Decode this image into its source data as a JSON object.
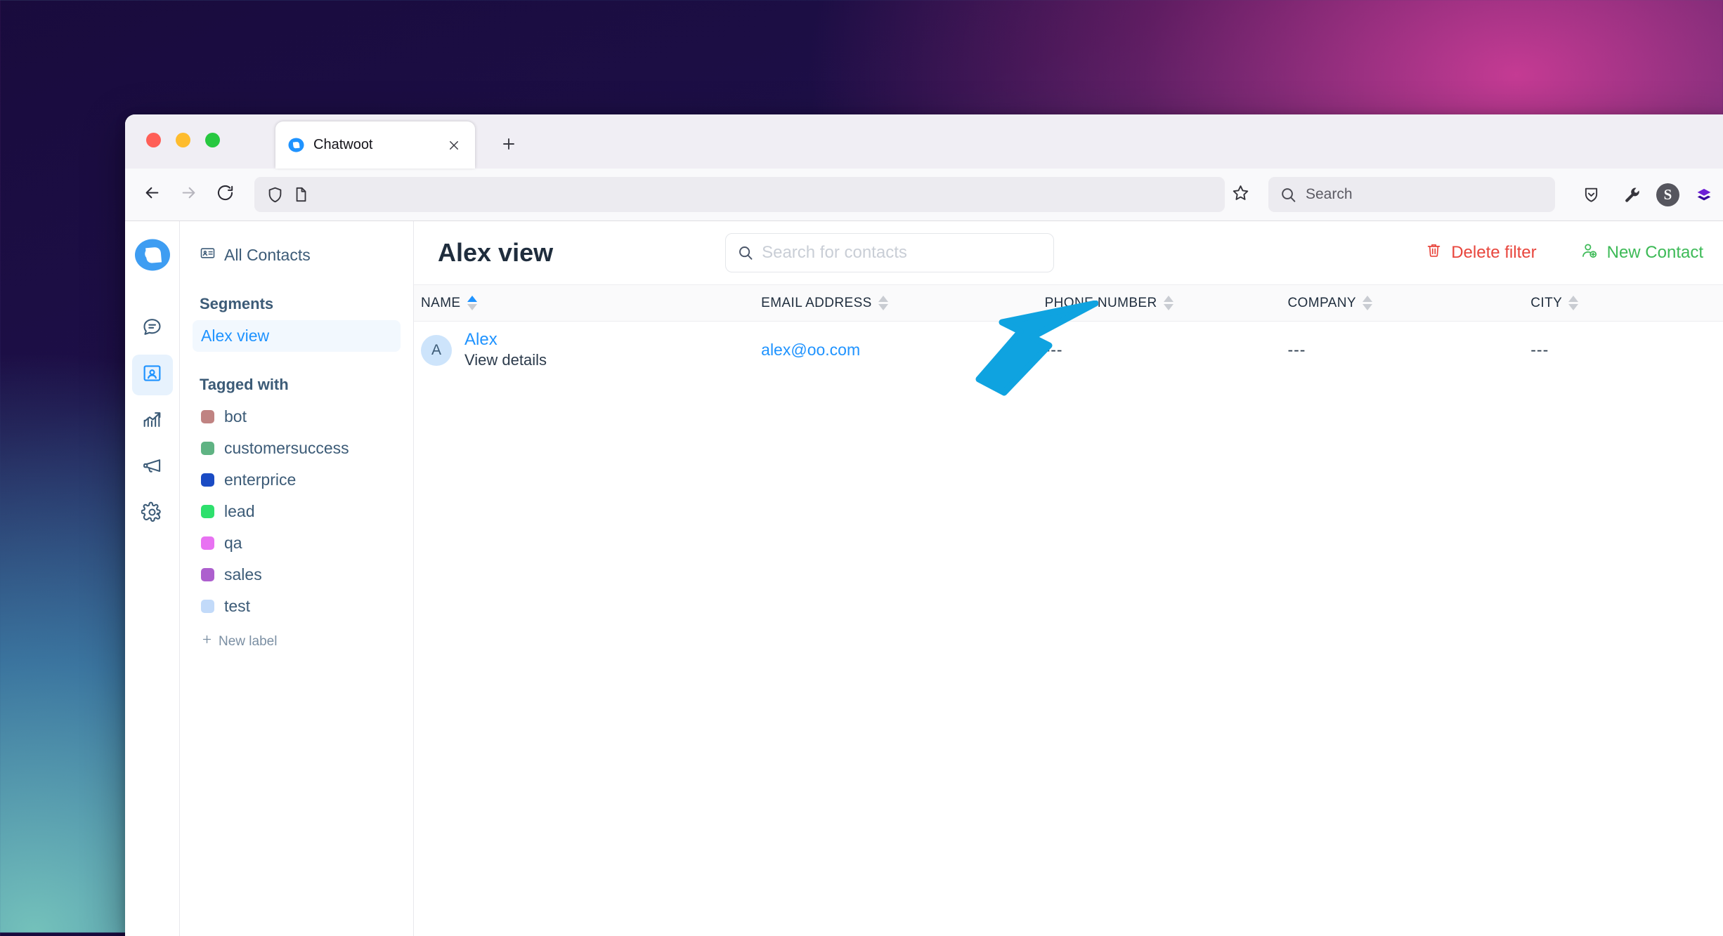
{
  "browser": {
    "tab": {
      "title": "Chatwoot",
      "favicon_icon": "chatwoot-logo-icon",
      "close_icon": "close-icon"
    },
    "new_tab_icon": "plus-icon",
    "nav": {
      "back_icon": "back-arrow-icon",
      "forward_icon": "forward-arrow-icon",
      "reload_icon": "reload-icon"
    },
    "urlbar": {
      "value": "",
      "shield_icon": "shield-icon",
      "page_icon": "page-document-icon",
      "bookmark_icon": "star-icon"
    },
    "search": {
      "placeholder": "Search",
      "icon": "search-icon"
    },
    "toolbar_right": {
      "pocket_icon": "pocket-shield-icon",
      "wrench_icon": "wrench-icon",
      "ext_s_label": "S",
      "layers_icon": "layers-diamond-icon"
    },
    "traffic_lights": [
      "close",
      "minimize",
      "maximize"
    ]
  },
  "rail": {
    "logo_icon": "chatwoot-logo-icon",
    "items": [
      {
        "name": "conversations",
        "icon": "chat-bubble-icon",
        "active": false
      },
      {
        "name": "contacts",
        "icon": "contact-book-icon",
        "active": true
      },
      {
        "name": "reports",
        "icon": "chart-trend-icon",
        "active": false
      },
      {
        "name": "campaigns",
        "icon": "megaphone-icon",
        "active": false
      },
      {
        "name": "settings",
        "icon": "gear-icon",
        "active": false
      }
    ]
  },
  "sidebar": {
    "all_contacts": {
      "label": "All Contacts",
      "icon": "contact-card-icon"
    },
    "segments_heading": "Segments",
    "segments": [
      {
        "label": "Alex view",
        "active": true
      }
    ],
    "tags_heading": "Tagged with",
    "tags": [
      {
        "label": "bot",
        "color": "#c08382"
      },
      {
        "label": "customersuccess",
        "color": "#5fb383"
      },
      {
        "label": "enterprice",
        "color": "#1a4bc4"
      },
      {
        "label": "lead",
        "color": "#2ee06d"
      },
      {
        "label": "qa",
        "color": "#e872f2"
      },
      {
        "label": "sales",
        "color": "#ad5fce"
      },
      {
        "label": "test",
        "color": "#c2daf9"
      }
    ],
    "new_label": {
      "label": "New label",
      "icon": "plus-icon"
    }
  },
  "main": {
    "page_title": "Alex view",
    "contact_search": {
      "placeholder": "Search for contacts",
      "value": "",
      "icon": "search-icon"
    },
    "delete_filter": {
      "label": "Delete filter",
      "icon": "trash-icon",
      "color": "#e8453c"
    },
    "new_contact": {
      "label": "New Contact",
      "icon": "user-plus-icon",
      "color": "#3dba57"
    },
    "table": {
      "columns": [
        {
          "label": "NAME",
          "sort": "asc"
        },
        {
          "label": "EMAIL ADDRESS",
          "sort": "none"
        },
        {
          "label": "PHONE NUMBER",
          "sort": "none"
        },
        {
          "label": "COMPANY",
          "sort": "none"
        },
        {
          "label": "CITY",
          "sort": "none"
        }
      ],
      "rows": [
        {
          "avatar_initial": "A",
          "name": "Alex",
          "view_details": "View details",
          "email": "alex@oo.com",
          "phone": "---",
          "company": "---",
          "city": "---"
        }
      ]
    }
  },
  "annotation": {
    "arrow_icon": "pointer-arrow-icon",
    "color": "#0fa3e0",
    "points_at": "Delete filter"
  }
}
